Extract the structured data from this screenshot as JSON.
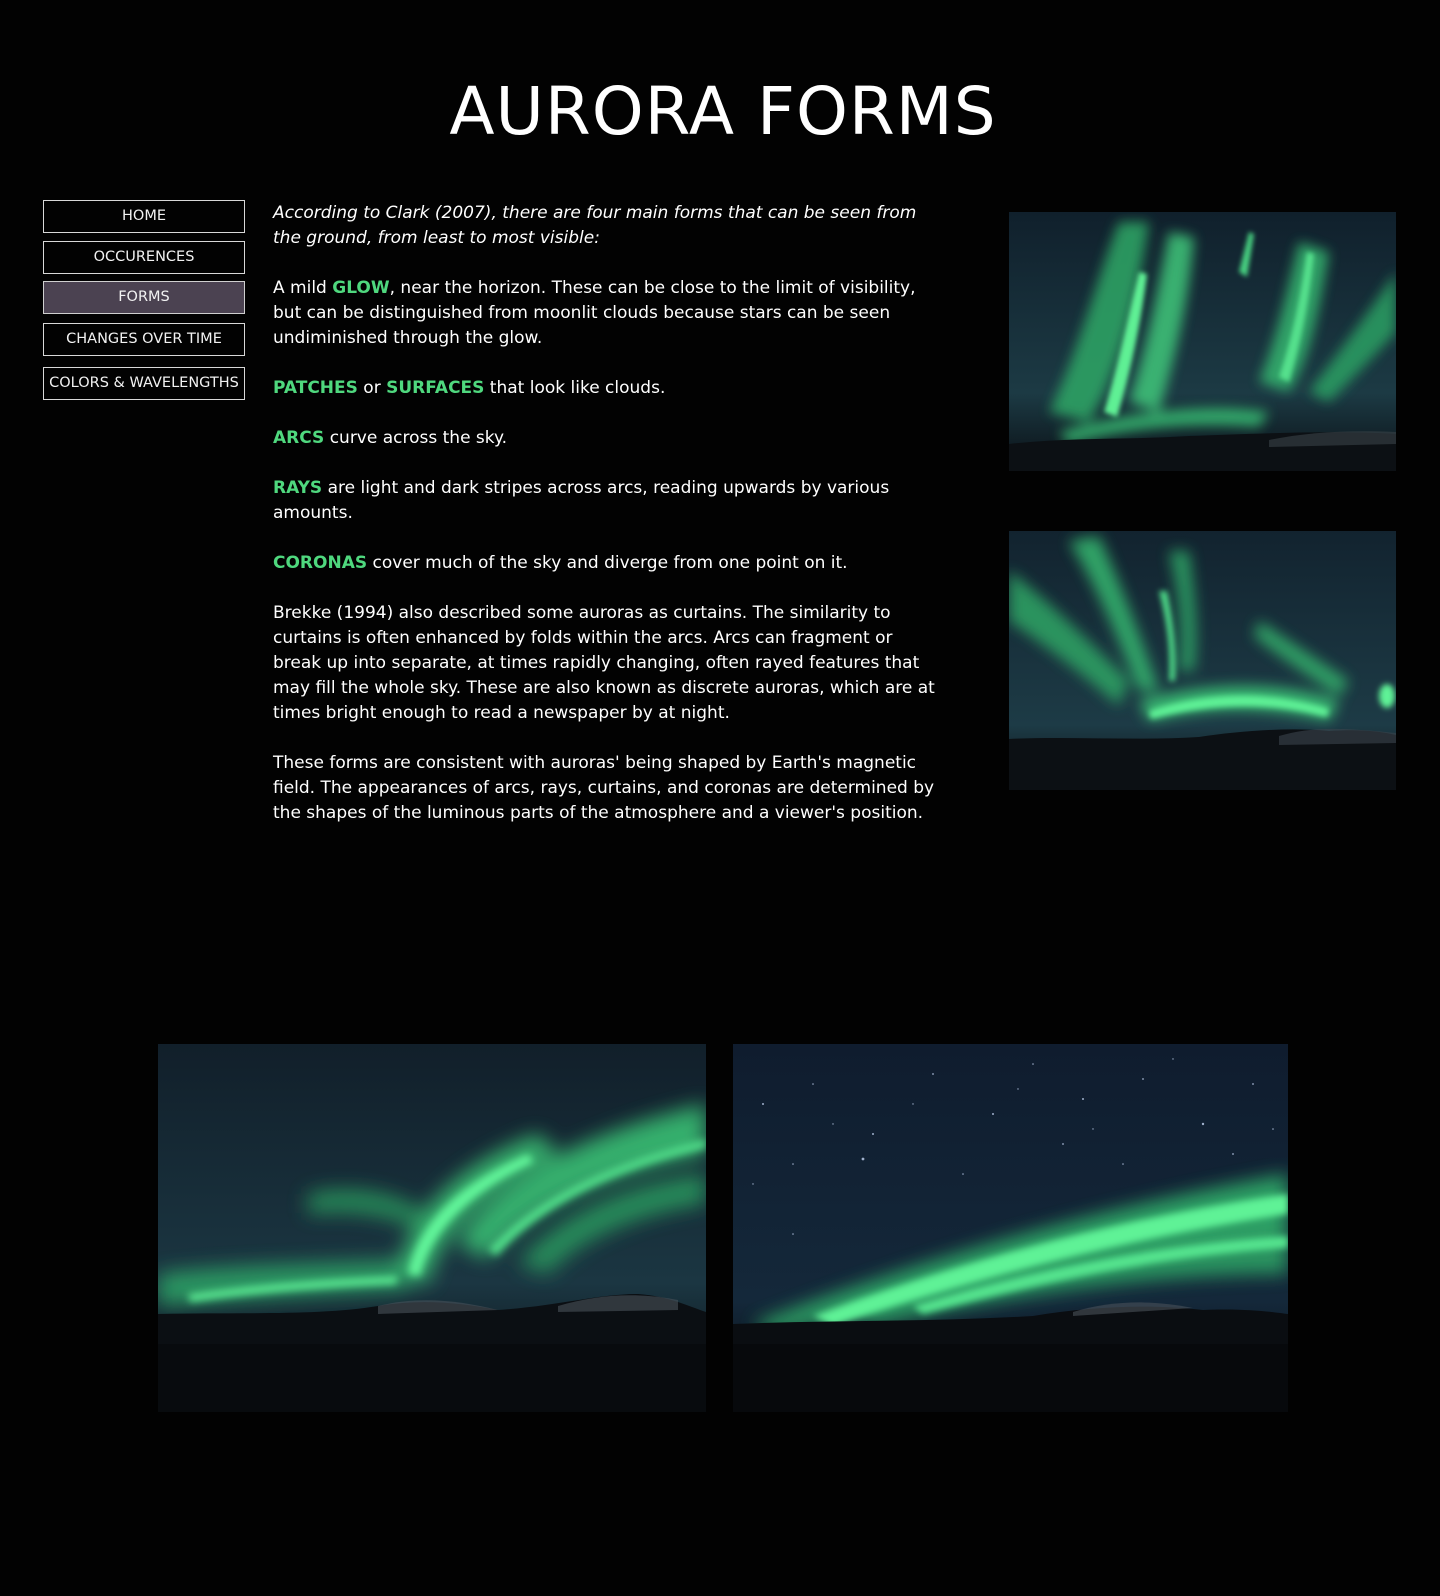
{
  "page": {
    "title": "AURORA FORMS"
  },
  "nav": {
    "items": [
      {
        "label": "HOME",
        "active": false
      },
      {
        "label": "OCCURENCES",
        "active": false
      },
      {
        "label": "FORMS",
        "active": true
      },
      {
        "label": "CHANGES OVER TIME",
        "active": false
      },
      {
        "label": "COLORS & WAVELENGTHS",
        "active": false
      }
    ]
  },
  "content": {
    "intro": "According to Clark (2007), there are four main forms that can be seen from the ground, from least to most visible:",
    "glow": {
      "before": "A mild ",
      "term": "GLOW",
      "after": ", near the horizon. These can be close to the limit of visibility, but can be distinguished from moonlit clouds because stars can be seen undiminished through the glow."
    },
    "patches": {
      "term1": "PATCHES",
      "mid": " or ",
      "term2": "SURFACES",
      "after": " that look like clouds."
    },
    "arcs": {
      "term": "ARCS",
      "after": " curve across the sky."
    },
    "rays": {
      "term": "RAYS",
      "after": " are light and dark stripes across arcs, reading upwards by various amounts."
    },
    "coronas": {
      "term": "CORONAS",
      "after": " cover much of the sky and diverge from one point on it."
    },
    "brekke": "Brekke (1994) also described some auroras as curtains. The similarity to curtains is often enhanced by folds within the arcs. Arcs can fragment or break up into separate, at times rapidly changing, often rayed features that may fill the whole sky. These are also known as discrete auroras, which are at times bright enough to read a newspaper by at night.",
    "consistent": "These forms are consistent with auroras' being shaped by Earth's magnetic field. The appearances of arcs, rays, curtains, and coronas are determined by the shapes of the luminous parts of the atmosphere and a viewer's position."
  },
  "colors": {
    "background": "#020202",
    "highlight": "#4fd87e",
    "nav_active": "#4b4251",
    "aurora_green": "#3fe07a",
    "sky_dark": "#142634"
  },
  "images": [
    {
      "icon": "aurora-photo-rays"
    },
    {
      "icon": "aurora-photo-curtains"
    },
    {
      "icon": "aurora-photo-swirl"
    },
    {
      "icon": "aurora-photo-arc"
    }
  ]
}
